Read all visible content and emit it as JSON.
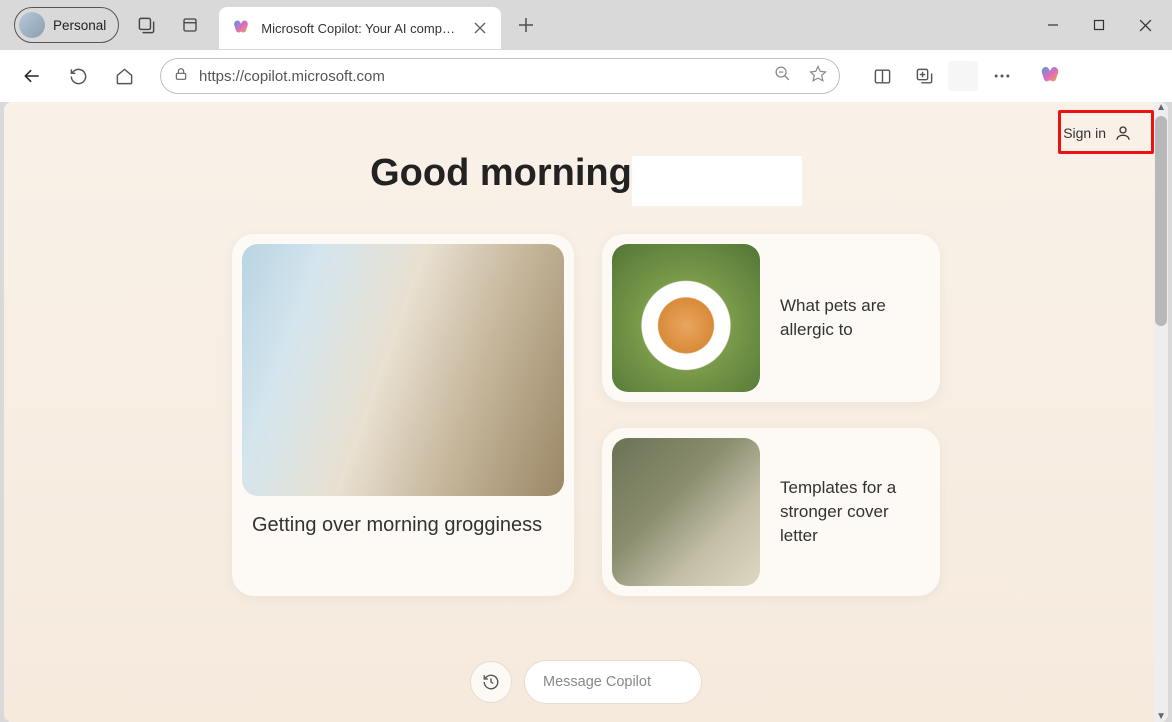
{
  "browser": {
    "profile_label": "Personal",
    "tab_title": "Microsoft Copilot: Your AI companion",
    "url": "https://copilot.microsoft.com"
  },
  "page": {
    "sign_in_label": "Sign in",
    "greeting": "Good morning",
    "cards": {
      "large": {
        "title": "Getting over morning grogginess"
      },
      "small1": {
        "title": "What pets are allergic to"
      },
      "small2": {
        "title": "Templates for a stronger cover letter"
      }
    },
    "message_placeholder": "Message Copilot"
  }
}
